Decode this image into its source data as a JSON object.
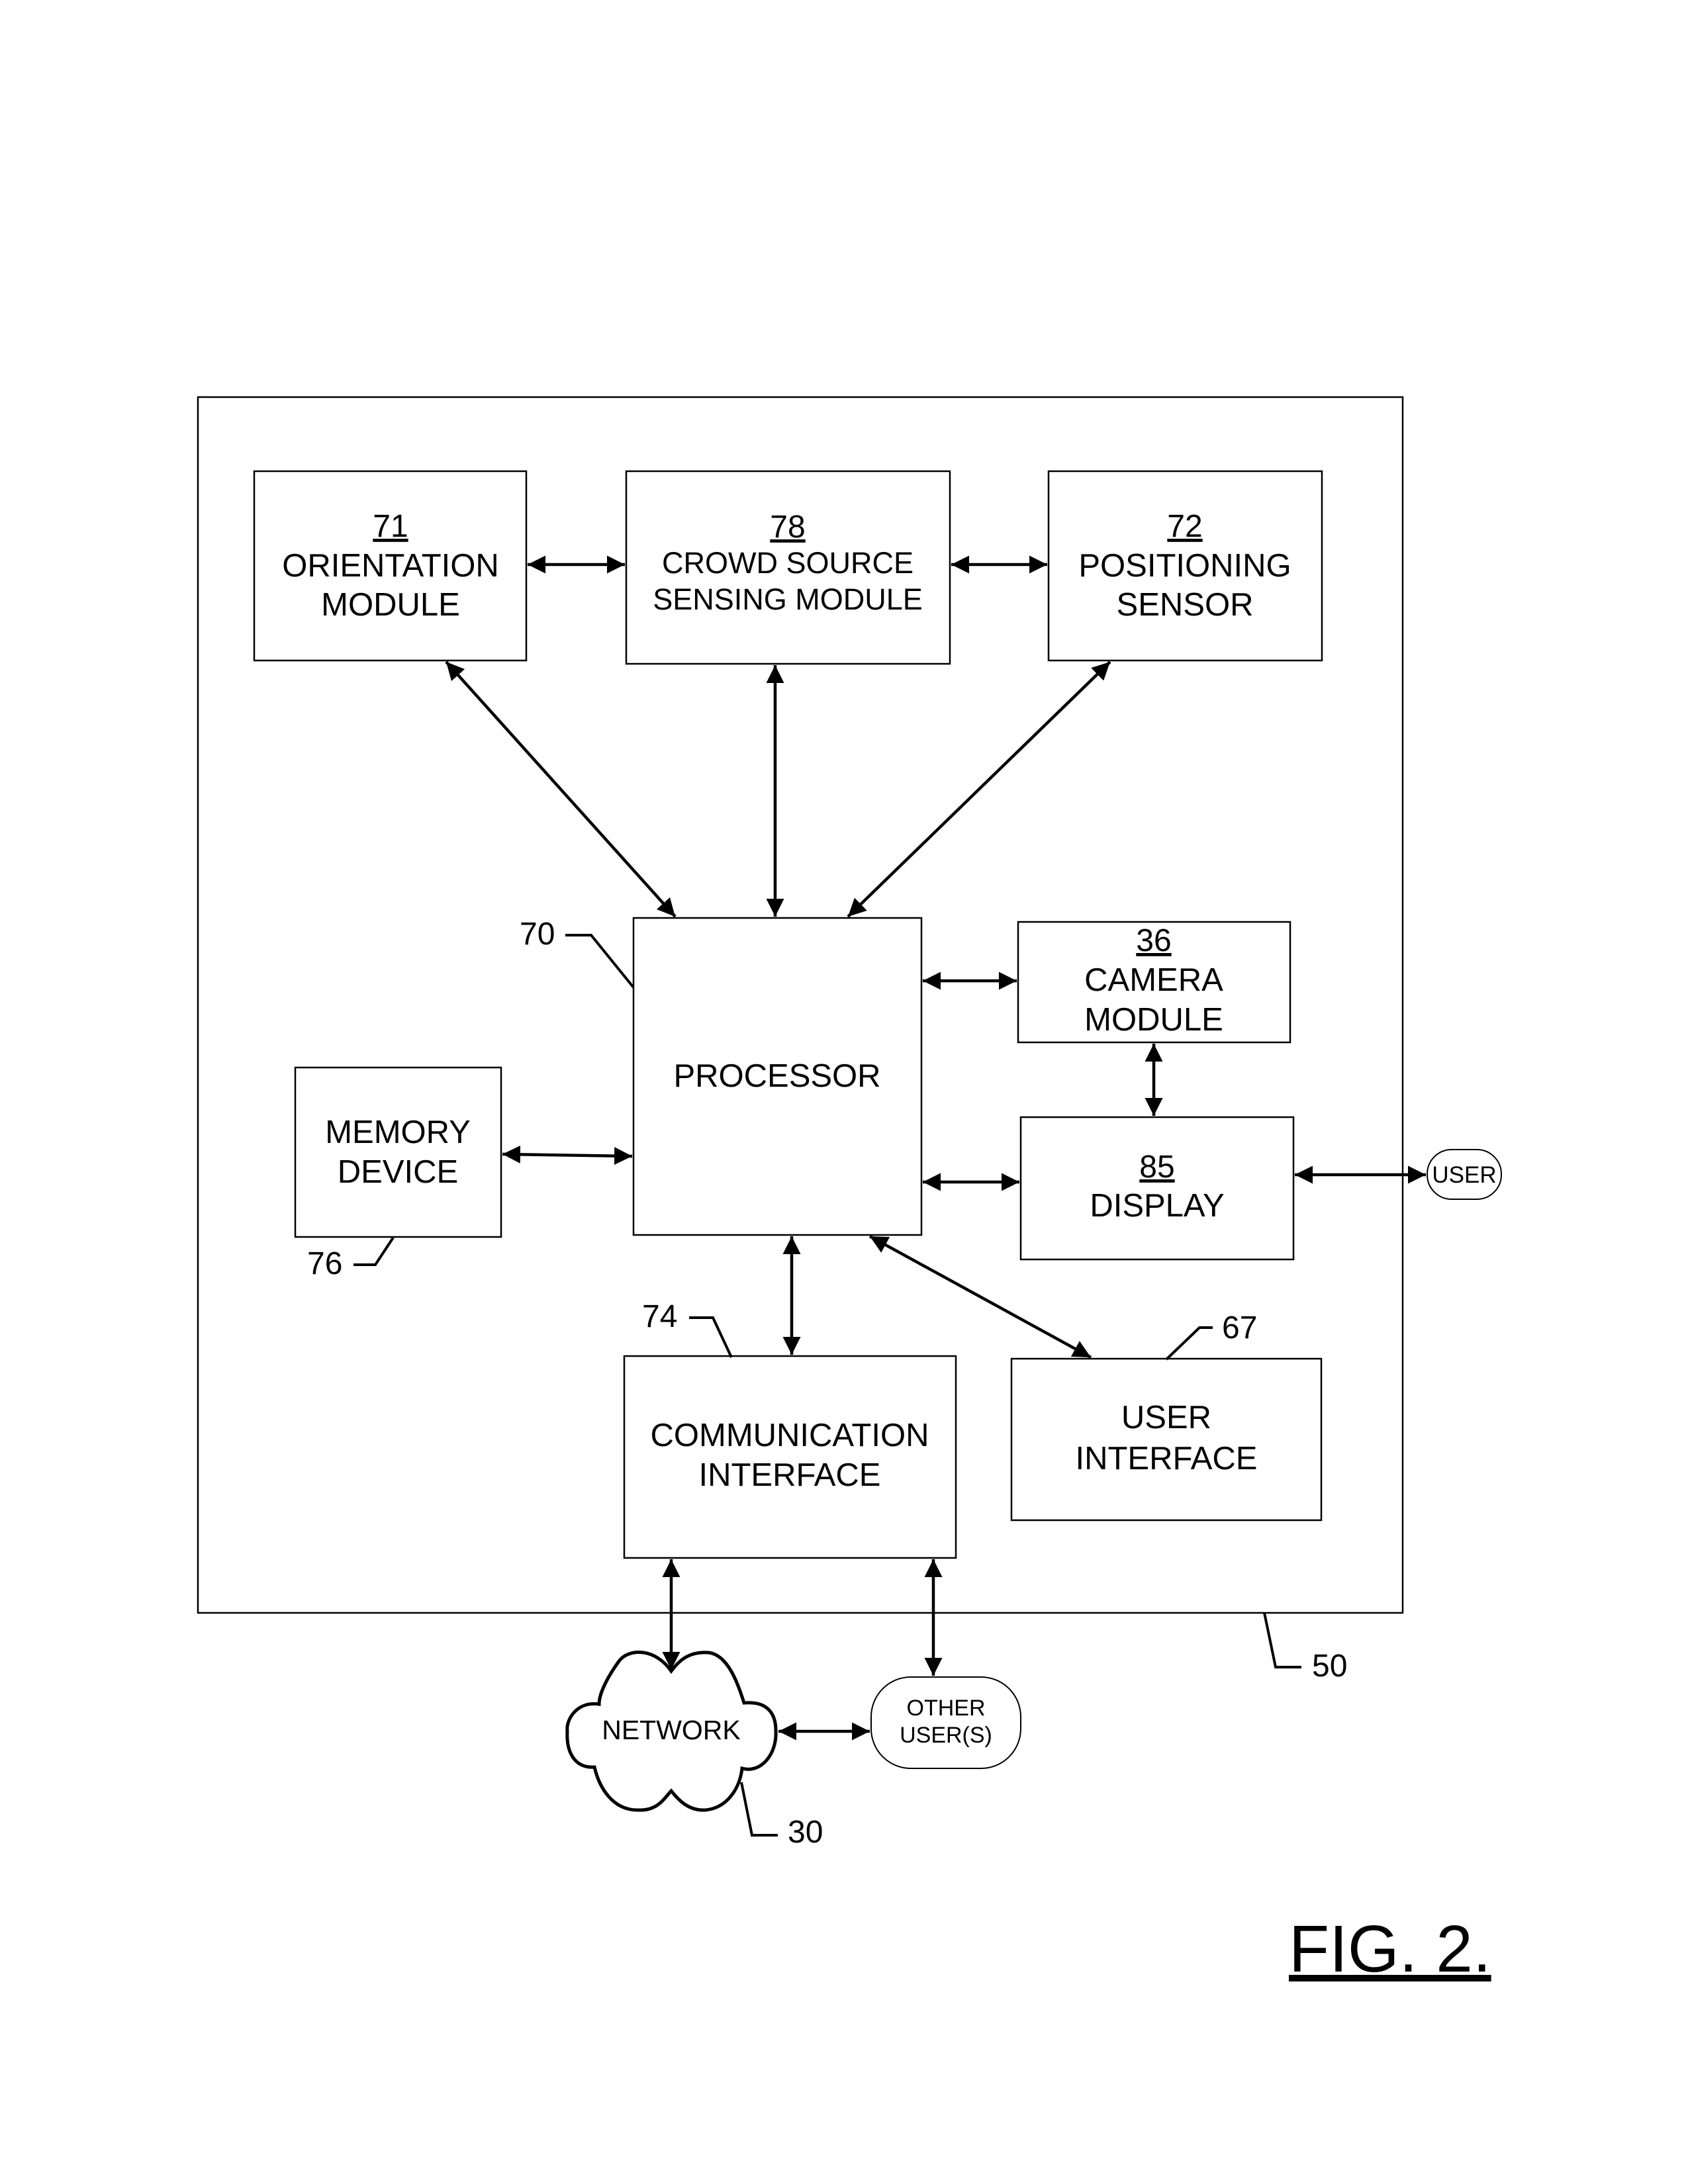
{
  "figure": {
    "title": "FIG. 2.",
    "apparatus_ref": "50"
  },
  "blocks": {
    "orientation": {
      "ref": "71",
      "lines": [
        "ORIENTATION",
        "MODULE"
      ]
    },
    "crowd_source": {
      "ref": "78",
      "lines": [
        "CROWD SOURCE",
        "SENSING MODULE"
      ]
    },
    "positioning": {
      "ref": "72",
      "lines": [
        "POSITIONING",
        "SENSOR"
      ]
    },
    "processor": {
      "ref": "70",
      "lines": [
        "PROCESSOR"
      ]
    },
    "camera": {
      "ref": "36",
      "lines": [
        "CAMERA",
        "MODULE"
      ]
    },
    "display": {
      "ref": "85",
      "lines": [
        "DISPLAY"
      ]
    },
    "memory": {
      "ref": "76",
      "lines": [
        "MEMORY",
        "DEVICE"
      ]
    },
    "communication": {
      "ref": "74",
      "lines": [
        "COMMUNICATION",
        "INTERFACE"
      ]
    },
    "user_interface": {
      "ref": "67",
      "lines": [
        "USER",
        "INTERFACE"
      ]
    }
  },
  "external": {
    "network": {
      "ref": "30",
      "label": "NETWORK"
    },
    "other_users": {
      "lines": [
        "OTHER",
        "USER(S)"
      ]
    },
    "user": {
      "label": "USER"
    }
  },
  "connections": [
    {
      "from": "orientation",
      "to": "crowd_source",
      "direction": "bidirectional"
    },
    {
      "from": "crowd_source",
      "to": "positioning",
      "direction": "bidirectional"
    },
    {
      "from": "orientation",
      "to": "processor",
      "direction": "bidirectional"
    },
    {
      "from": "crowd_source",
      "to": "processor",
      "direction": "bidirectional"
    },
    {
      "from": "positioning",
      "to": "processor",
      "direction": "bidirectional"
    },
    {
      "from": "processor",
      "to": "camera",
      "direction": "bidirectional"
    },
    {
      "from": "camera",
      "to": "display",
      "direction": "bidirectional"
    },
    {
      "from": "processor",
      "to": "display",
      "direction": "bidirectional"
    },
    {
      "from": "display",
      "to": "user",
      "direction": "bidirectional"
    },
    {
      "from": "memory",
      "to": "processor",
      "direction": "bidirectional"
    },
    {
      "from": "processor",
      "to": "communication",
      "direction": "bidirectional"
    },
    {
      "from": "processor",
      "to": "user_interface",
      "direction": "bidirectional"
    },
    {
      "from": "communication",
      "to": "network",
      "direction": "bidirectional"
    },
    {
      "from": "communication",
      "to": "other_users",
      "direction": "bidirectional"
    },
    {
      "from": "network",
      "to": "other_users",
      "direction": "bidirectional"
    }
  ]
}
